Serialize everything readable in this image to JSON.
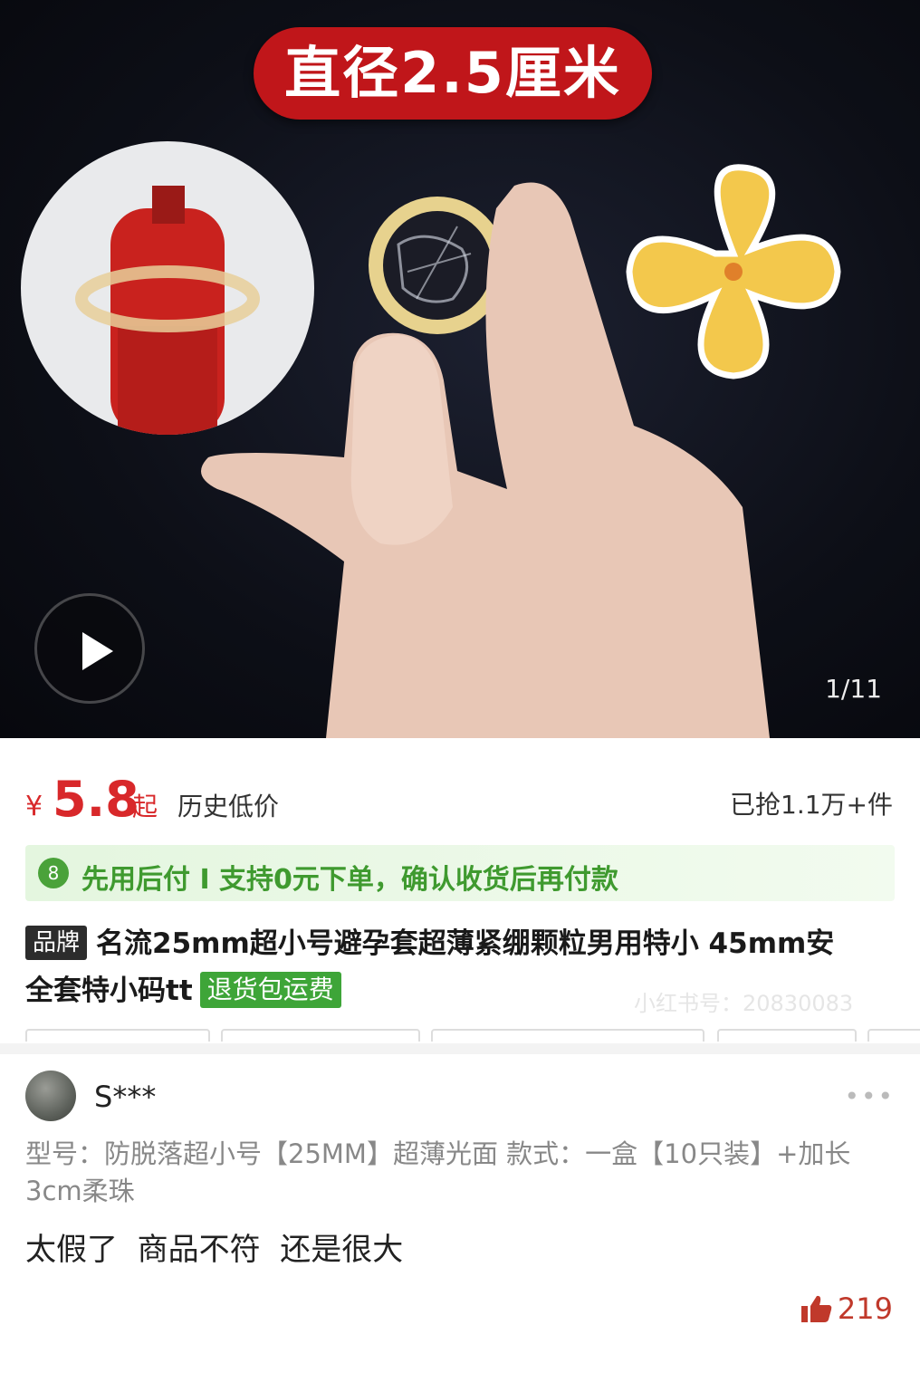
{
  "hero": {
    "title": "直径2.5厘米",
    "image_counter": "1/11",
    "icons": {
      "play": "play-icon"
    }
  },
  "price": {
    "currency": "¥",
    "value": "5.8",
    "suffix": "起",
    "tag": "历史低价",
    "sold": "已抢1.1万+件"
  },
  "pay_later": {
    "text": "先用后付 I 支持0元下单，确认收货后再付款",
    "icon": "pay-later-badge-icon",
    "badge_char": "8"
  },
  "product": {
    "brand_tag": "品牌",
    "title": "名流25mm超小号避孕套超薄紧绷颗粒男用特小 45mm安全套特小码tt",
    "return_tag": "退货包运费",
    "watermark": "小红书号：20830083"
  },
  "review": {
    "username": "S***",
    "more_label": "•••",
    "spec": "型号：防脱落超小号【25MM】超薄光面   款式：一盒【10只装】+加长3cm柔珠",
    "comment": "太假了  商品不符  还是很大",
    "likes": "219",
    "icons": {
      "like": "thumbs-up-icon",
      "more": "more-icon"
    }
  },
  "colors": {
    "accent_red": "#d8282a",
    "paylater_green": "#3f9a2f",
    "return_green": "#3ea538",
    "title_banner": "#c0161a"
  }
}
